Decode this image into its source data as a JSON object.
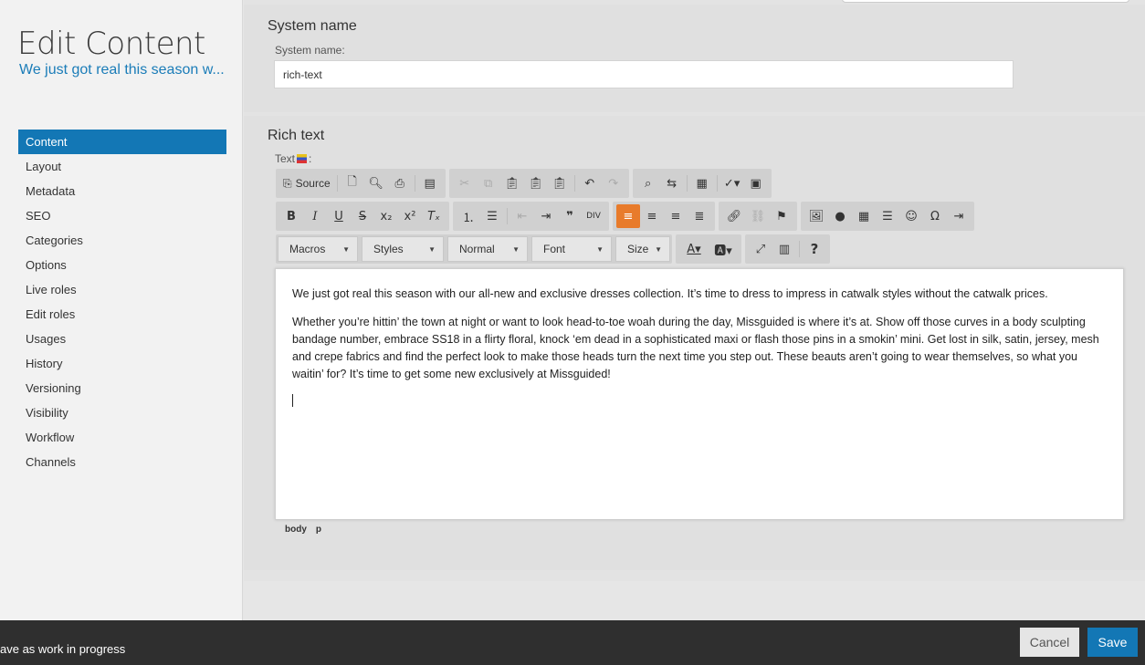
{
  "sidebar": {
    "title": "Edit Content",
    "subtitle": "We just got real this season w...",
    "items": [
      {
        "label": "Content",
        "active": true
      },
      {
        "label": "Layout"
      },
      {
        "label": "Metadata"
      },
      {
        "label": "SEO"
      },
      {
        "label": "Categories"
      },
      {
        "label": "Options"
      },
      {
        "label": "Live roles"
      },
      {
        "label": "Edit roles"
      },
      {
        "label": "Usages"
      },
      {
        "label": "History"
      },
      {
        "label": "Versioning"
      },
      {
        "label": "Visibility"
      },
      {
        "label": "Workflow"
      },
      {
        "label": "Channels"
      }
    ]
  },
  "system_name_panel": {
    "title": "System name",
    "field_label": "System name:",
    "value": "rich-text"
  },
  "rich_text_panel": {
    "title": "Rich text",
    "field_label": "Text",
    "field_suffix": ":",
    "toolbar": {
      "source_label": "Source",
      "macros": "Macros",
      "styles": "Styles",
      "format": "Normal",
      "font": "Font",
      "size": "Size",
      "help": "?"
    },
    "paragraphs": [
      "We just got real this season with our all-new and exclusive dresses collection. It’s time to dress to impress in catwalk styles without the catwalk prices.",
      "Whether you’re hittin’ the town at night or want to look head-to-toe woah during the day, Missguided is where it’s at. Show off those curves in a body sculpting bandage number, embrace SS18 in a flirty floral, knock ‘em dead in a sophisticated maxi or flash those pins in a smokin’ mini. Get lost in silk, satin, jersey, mesh and crepe fabrics and find the perfect look to make those heads turn the next time you step out. These beauts aren’t going to wear themselves, so what you waitin’ for? It’s time to get some new exclusively at Missguided!"
    ],
    "path": [
      "body",
      "p"
    ]
  },
  "footer": {
    "wip_label": "ave as work in progress",
    "cancel": "Cancel",
    "save": "Save"
  },
  "colors": {
    "accent": "#1377b5",
    "active_tool": "#e87b2b",
    "footer_bg": "#2f2f2f"
  }
}
